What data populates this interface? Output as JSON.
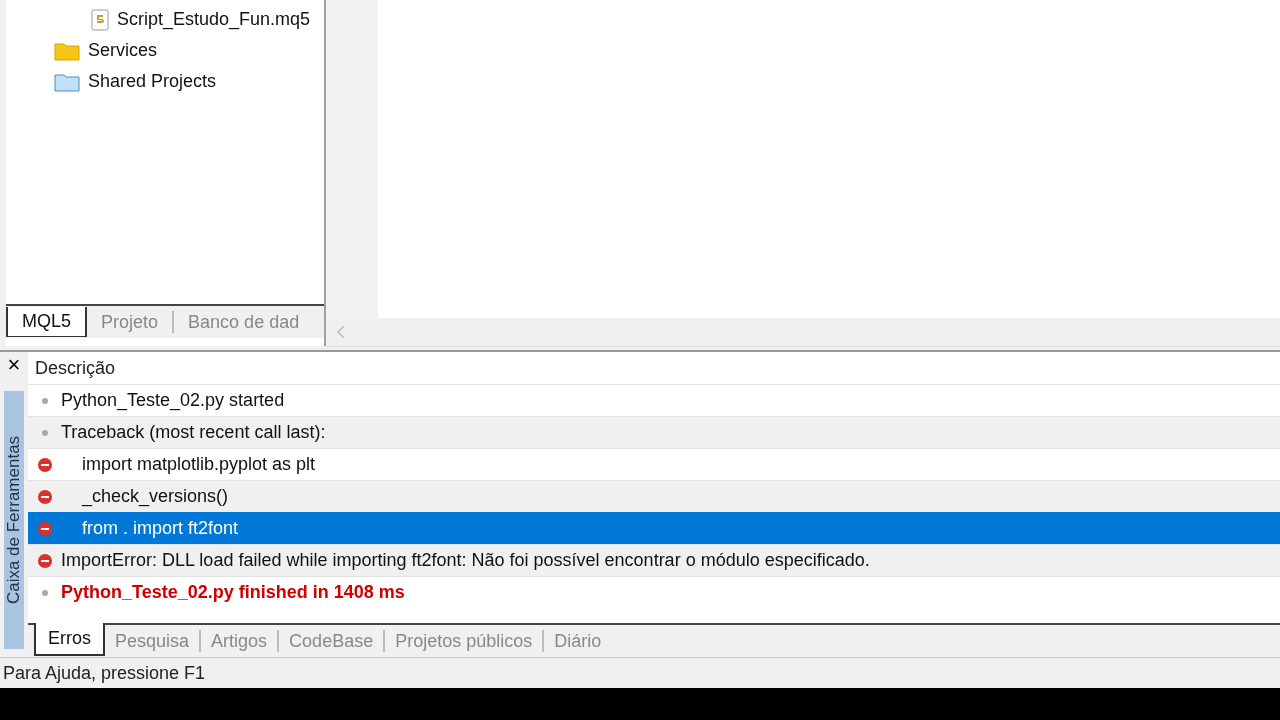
{
  "navigator": {
    "tree": [
      {
        "children": [
          {
            "label": "Script_Estudo_Fun.mq5",
            "kind": "script"
          }
        ]
      },
      {
        "label": "Services",
        "kind": "folder"
      },
      {
        "label": "Shared Projects",
        "kind": "shared"
      }
    ],
    "tabs": [
      {
        "label": "MQL5",
        "selected": true
      },
      {
        "label": "Projeto",
        "selected": false
      },
      {
        "label": "Banco de dad",
        "selected": false
      }
    ]
  },
  "toolbox": {
    "side_title": "Caixa de Ferramentas",
    "close": "×",
    "column": "Descrição",
    "rows": [
      {
        "kind": "info",
        "text": "Python_Teste_02.py started",
        "indented": false,
        "highlight": false,
        "selected": false
      },
      {
        "kind": "info",
        "text": "Traceback (most recent call last):",
        "indented": false,
        "highlight": false,
        "selected": false
      },
      {
        "kind": "error",
        "text": "import matplotlib.pyplot as plt",
        "indented": true,
        "highlight": false,
        "selected": false
      },
      {
        "kind": "error",
        "text": "_check_versions()",
        "indented": true,
        "highlight": false,
        "selected": false
      },
      {
        "kind": "error",
        "text": "from . import ft2font",
        "indented": true,
        "highlight": false,
        "selected": true
      },
      {
        "kind": "error",
        "text": "ImportError: DLL load failed while importing ft2font: Não foi possível encontrar o módulo especificado.",
        "indented": false,
        "highlight": false,
        "selected": false
      },
      {
        "kind": "info",
        "text": "Python_Teste_02.py finished in 1408 ms",
        "indented": false,
        "highlight": true,
        "selected": false
      }
    ],
    "tabs": [
      {
        "label": "Erros",
        "selected": true
      },
      {
        "label": "Pesquisa",
        "selected": false
      },
      {
        "label": "Artigos",
        "selected": false
      },
      {
        "label": "CodeBase",
        "selected": false
      },
      {
        "label": "Projetos públicos",
        "selected": false
      },
      {
        "label": "Diário",
        "selected": false
      }
    ]
  },
  "status_bar": {
    "text": "Para Ajuda, pressione F1"
  }
}
